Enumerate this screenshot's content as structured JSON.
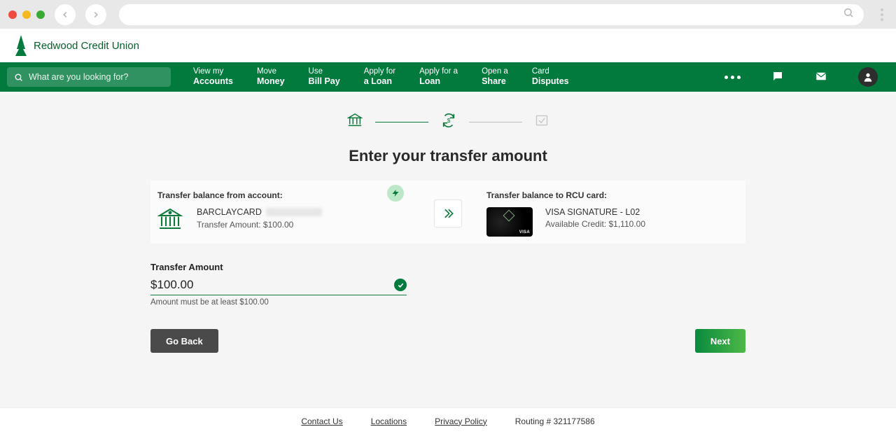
{
  "brand": {
    "name": "Redwood Credit Union"
  },
  "search": {
    "placeholder": "What are you looking for?"
  },
  "nav": [
    {
      "l1": "View my",
      "l2": "Accounts"
    },
    {
      "l1": "Move",
      "l2": "Money"
    },
    {
      "l1": "Use",
      "l2": "Bill Pay"
    },
    {
      "l1": "Apply for",
      "l2": "a Loan"
    },
    {
      "l1": "Apply for a",
      "l2": "Loan"
    },
    {
      "l1": "Open a",
      "l2": "Share"
    },
    {
      "l1": "Card",
      "l2": "Disputes"
    }
  ],
  "page": {
    "title": "Enter your transfer amount"
  },
  "from": {
    "label": "Transfer balance from account:",
    "account_name": "BARCLAYCARD",
    "transfer_amount_line": "Transfer Amount: $100.00"
  },
  "to": {
    "label": "Transfer balance to RCU card:",
    "card_name": "VISA SIGNATURE - L02",
    "available_credit_line": "Available Credit: $1,110.00"
  },
  "amount": {
    "label": "Transfer Amount",
    "value": "$100.00",
    "hint": "Amount must be at least $100.00"
  },
  "buttons": {
    "back": "Go Back",
    "next": "Next"
  },
  "footer": {
    "contact": "Contact Us",
    "locations": "Locations",
    "privacy": "Privacy Policy",
    "routing": "Routing # 321177586"
  }
}
